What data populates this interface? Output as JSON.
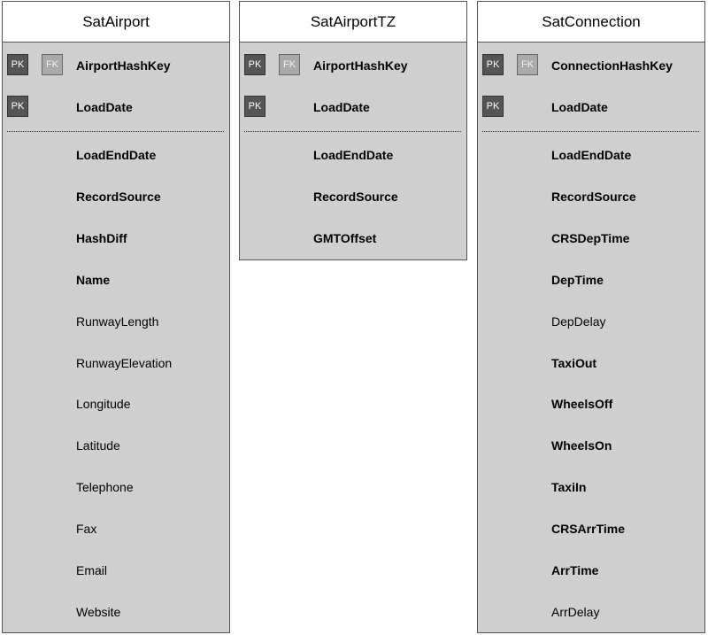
{
  "entities": [
    {
      "id": "sat-airport",
      "name": "SatAirport",
      "keys": [
        {
          "name": "AirportHashKey",
          "badges": [
            "PK",
            "FK"
          ],
          "bold": true
        },
        {
          "name": "LoadDate",
          "badges": [
            "PK"
          ],
          "bold": true
        }
      ],
      "attributes": [
        {
          "name": "LoadEndDate",
          "bold": true
        },
        {
          "name": "RecordSource",
          "bold": true
        },
        {
          "name": "HashDiff",
          "bold": true
        },
        {
          "name": "Name",
          "bold": true
        },
        {
          "name": "RunwayLength",
          "bold": false
        },
        {
          "name": "RunwayElevation",
          "bold": false
        },
        {
          "name": "Longitude",
          "bold": false
        },
        {
          "name": "Latitude",
          "bold": false
        },
        {
          "name": "Telephone",
          "bold": false
        },
        {
          "name": "Fax",
          "bold": false
        },
        {
          "name": "Email",
          "bold": false
        },
        {
          "name": "Website",
          "bold": false
        }
      ]
    },
    {
      "id": "sat-airport-tz",
      "name": "SatAirportTZ",
      "keys": [
        {
          "name": "AirportHashKey",
          "badges": [
            "PK",
            "FK"
          ],
          "bold": true
        },
        {
          "name": "LoadDate",
          "badges": [
            "PK"
          ],
          "bold": true
        }
      ],
      "attributes": [
        {
          "name": "LoadEndDate",
          "bold": true
        },
        {
          "name": "RecordSource",
          "bold": true
        },
        {
          "name": "GMTOffset",
          "bold": true
        }
      ]
    },
    {
      "id": "sat-connection",
      "name": "SatConnection",
      "keys": [
        {
          "name": "ConnectionHashKey",
          "badges": [
            "PK",
            "FK"
          ],
          "bold": true
        },
        {
          "name": "LoadDate",
          "badges": [
            "PK"
          ],
          "bold": true
        }
      ],
      "attributes": [
        {
          "name": "LoadEndDate",
          "bold": true
        },
        {
          "name": "RecordSource",
          "bold": true
        },
        {
          "name": "CRSDepTime",
          "bold": true
        },
        {
          "name": "DepTime",
          "bold": true
        },
        {
          "name": "DepDelay",
          "bold": false
        },
        {
          "name": "TaxiOut",
          "bold": true
        },
        {
          "name": "WheelsOff",
          "bold": true
        },
        {
          "name": "WheelsOn",
          "bold": true
        },
        {
          "name": "TaxiIn",
          "bold": true
        },
        {
          "name": "CRSArrTime",
          "bold": true
        },
        {
          "name": "ArrTime",
          "bold": true
        },
        {
          "name": "ArrDelay",
          "bold": false
        }
      ]
    }
  ]
}
